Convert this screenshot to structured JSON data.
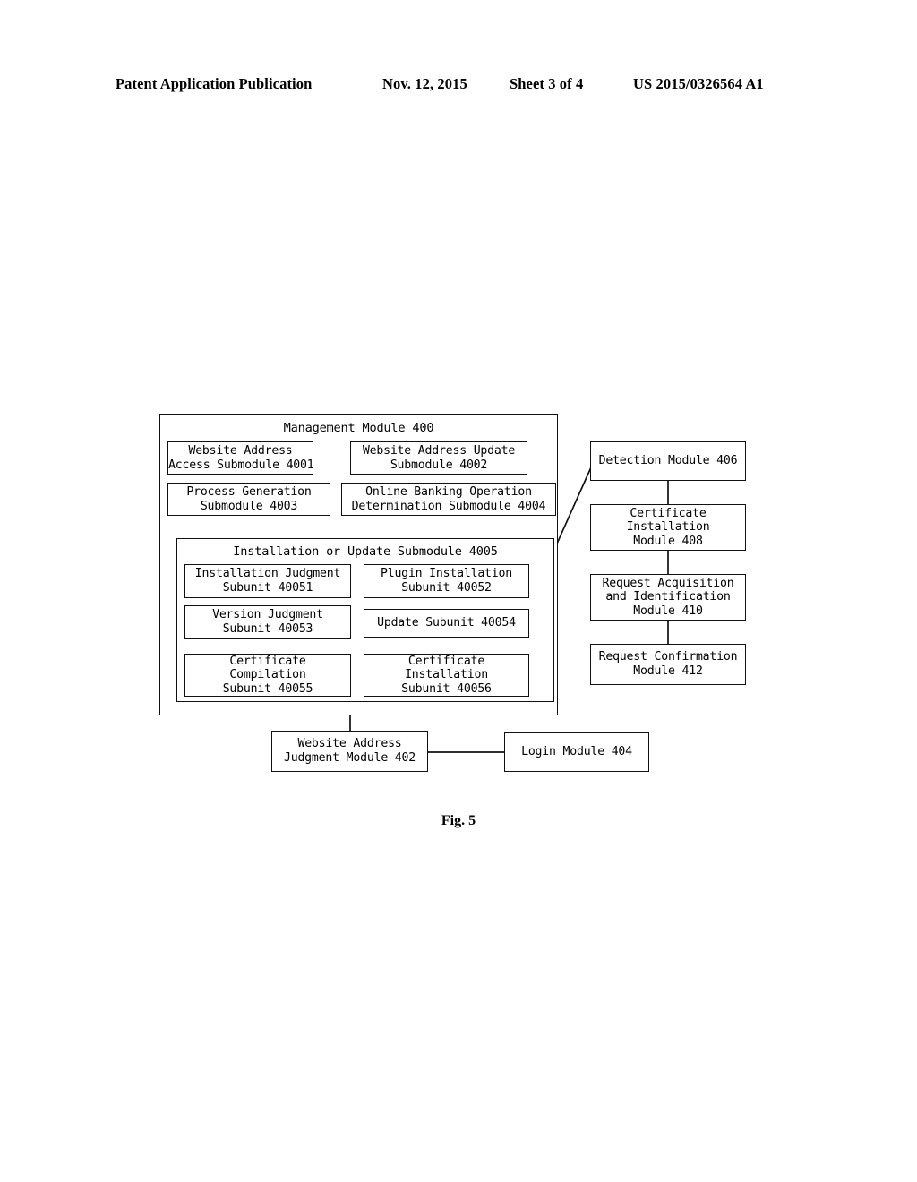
{
  "header": {
    "publication": "Patent Application Publication",
    "date": "Nov. 12, 2015",
    "sheet": "Sheet 3 of 4",
    "patent_number": "US 2015/0326564 A1"
  },
  "figure": {
    "caption": "Fig. 5",
    "type": "block-diagram"
  },
  "diagram": {
    "management_module": {
      "title": "Management Module 400",
      "submodules": {
        "m4001": {
          "line1": "Website Address",
          "line2": "Access Submodule 4001"
        },
        "m4002": {
          "line1": "Website Address Update",
          "line2": "Submodule 4002"
        },
        "m4003": {
          "line1": "Process Generation",
          "line2": "Submodule 4003"
        },
        "m4004": {
          "line1": "Online Banking Operation",
          "line2": "Determination Submodule 4004"
        }
      },
      "install_or_update": {
        "title": "Installation or Update Submodule 4005",
        "subunits": {
          "s40051": {
            "line1": "Installation Judgment",
            "line2": "Subunit 40051"
          },
          "s40052": {
            "line1": "Plugin Installation",
            "line2": "Subunit 40052"
          },
          "s40053": {
            "line1": "Version Judgment",
            "line2": "Subunit 40053"
          },
          "s40054": {
            "line1": "Update Subunit 40054",
            "line2": ""
          },
          "s40055": {
            "line1": "Certificate",
            "line2": "Compilation",
            "line3": "Subunit 40055"
          },
          "s40056": {
            "line1": "Certificate",
            "line2": "Installation",
            "line3": "Subunit 40056"
          }
        }
      }
    },
    "right_column": {
      "m406": {
        "line1": "Detection Module 406",
        "line2": ""
      },
      "m408": {
        "line1": "Certificate",
        "line2": "Installation",
        "line3": "Module 408"
      },
      "m410": {
        "line1": "Request Acquisition",
        "line2": "and Identification",
        "line3": "Module 410"
      },
      "m412": {
        "line1": "Request Confirmation",
        "line2": "Module 412"
      }
    },
    "bottom_row": {
      "m402": {
        "line1": "Website Address",
        "line2": "Judgment Module 402"
      },
      "m404": {
        "line1": "Login Module 404",
        "line2": ""
      }
    }
  }
}
